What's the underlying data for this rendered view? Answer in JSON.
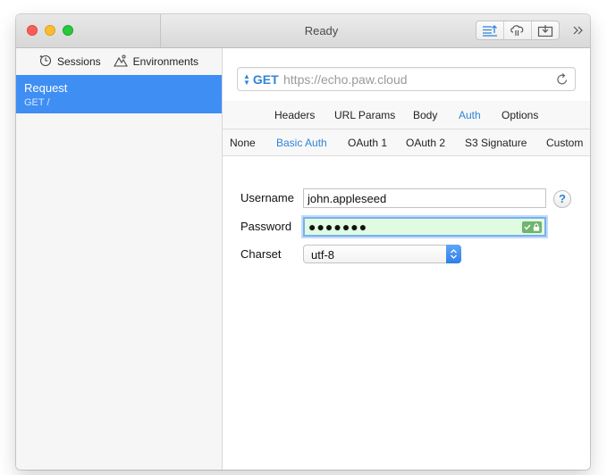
{
  "window": {
    "title": "Ready",
    "toolbar_icons": [
      "request-list-icon",
      "cloud-sync-icon",
      "export-icon"
    ],
    "more_icon": "double-chevron-right-icon"
  },
  "sidebar": {
    "tabs": [
      {
        "label": "Sessions",
        "icon": "clock-icon"
      },
      {
        "label": "Environments",
        "icon": "mountain-icon"
      }
    ],
    "items": [
      {
        "name": "Request",
        "subtitle": "GET /",
        "selected": true
      }
    ]
  },
  "request": {
    "method": "GET",
    "url_placeholder": "https://echo.paw.cloud",
    "reload_icon": "reload-icon"
  },
  "tabs": {
    "labels": [
      "Headers",
      "URL Params",
      "Body",
      "Auth",
      "Options"
    ],
    "active": "Auth"
  },
  "auth_tabs": {
    "labels": [
      "None",
      "Basic Auth",
      "OAuth 1",
      "OAuth 2",
      "S3 Signature",
      "Custom"
    ],
    "active": "Basic Auth"
  },
  "form": {
    "username_label": "Username",
    "username_value": "john.appleseed",
    "password_label": "Password",
    "password_masked": "●●●●●●●",
    "charset_label": "Charset",
    "charset_value": "utf-8",
    "help_label": "?"
  },
  "colors": {
    "accent": "#2f84d8",
    "selection": "#3f8ef4",
    "password_fill": "#dffbe0"
  }
}
